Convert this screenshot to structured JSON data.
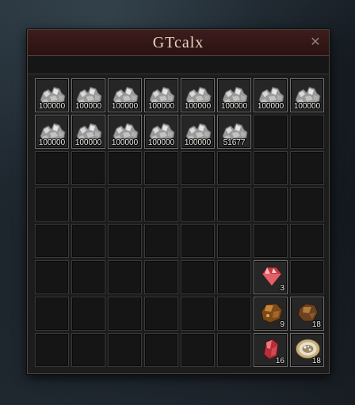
{
  "window": {
    "title": "GTcalx",
    "close_glyph": "✕"
  },
  "inventory": {
    "columns": 8,
    "rows": 8,
    "slots": [
      {
        "index": 0,
        "item": "silver-ore-icon",
        "qty": "100000"
      },
      {
        "index": 1,
        "item": "silver-ore-icon",
        "qty": "100000"
      },
      {
        "index": 2,
        "item": "silver-ore-icon",
        "qty": "100000"
      },
      {
        "index": 3,
        "item": "silver-ore-icon",
        "qty": "100000"
      },
      {
        "index": 4,
        "item": "silver-ore-icon",
        "qty": "100000"
      },
      {
        "index": 5,
        "item": "silver-ore-icon",
        "qty": "100000"
      },
      {
        "index": 6,
        "item": "silver-ore-icon",
        "qty": "100000"
      },
      {
        "index": 7,
        "item": "silver-ore-icon",
        "qty": "100000"
      },
      {
        "index": 8,
        "item": "silver-ore-icon",
        "qty": "100000"
      },
      {
        "index": 9,
        "item": "silver-ore-icon",
        "qty": "100000"
      },
      {
        "index": 10,
        "item": "silver-ore-icon",
        "qty": "100000"
      },
      {
        "index": 11,
        "item": "silver-ore-icon",
        "qty": "100000"
      },
      {
        "index": 12,
        "item": "silver-ore-icon",
        "qty": "100000"
      },
      {
        "index": 13,
        "item": "silver-ore-icon",
        "qty": "51677"
      },
      {
        "index": 46,
        "item": "red-gem-icon",
        "qty": "3"
      },
      {
        "index": 54,
        "item": "amber-stone-icon",
        "qty": "9"
      },
      {
        "index": 55,
        "item": "brown-gem-icon",
        "qty": "18"
      },
      {
        "index": 62,
        "item": "red-crystal-icon",
        "qty": "16"
      },
      {
        "index": 63,
        "item": "geode-icon",
        "qty": "18"
      }
    ]
  },
  "colors": {
    "titlebar": "#3e1c1c",
    "title_text": "#e4d6bf",
    "slot_border": "#6f6f6f",
    "panel_bg": "#1c1c1c"
  }
}
